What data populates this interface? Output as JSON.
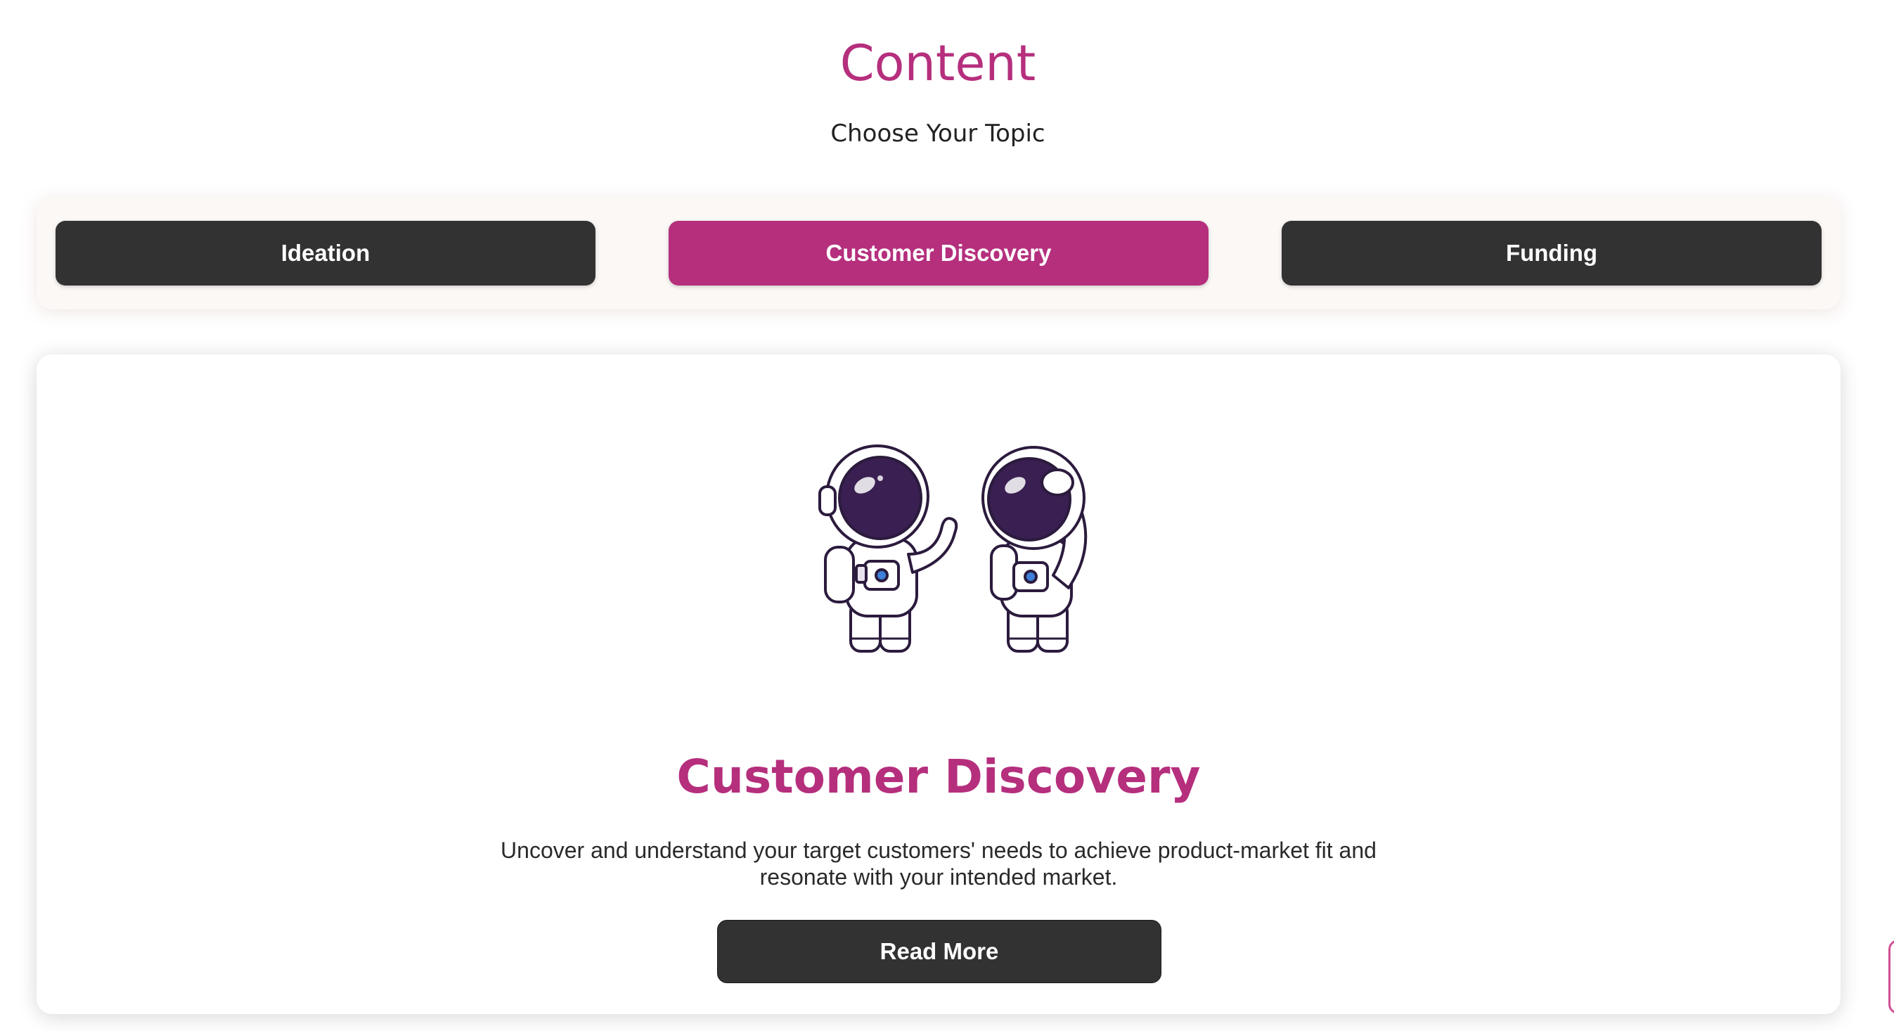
{
  "header": {
    "title": "Content",
    "subtitle": "Choose Your Topic"
  },
  "tabs": [
    {
      "label": "Ideation",
      "active": false
    },
    {
      "label": "Customer Discovery",
      "active": true
    },
    {
      "label": "Funding",
      "active": false
    }
  ],
  "card": {
    "illustration_icon": "two-astronauts-illustration",
    "title": "Customer Discovery",
    "description": "Uncover and understand your target customers' needs to achieve product-market fit and resonate with your intended market.",
    "button_label": "Read More"
  },
  "colors": {
    "accent": "#b52f7d",
    "dark_button": "#323232",
    "tab_bar_bg": "#fbf8f6"
  }
}
